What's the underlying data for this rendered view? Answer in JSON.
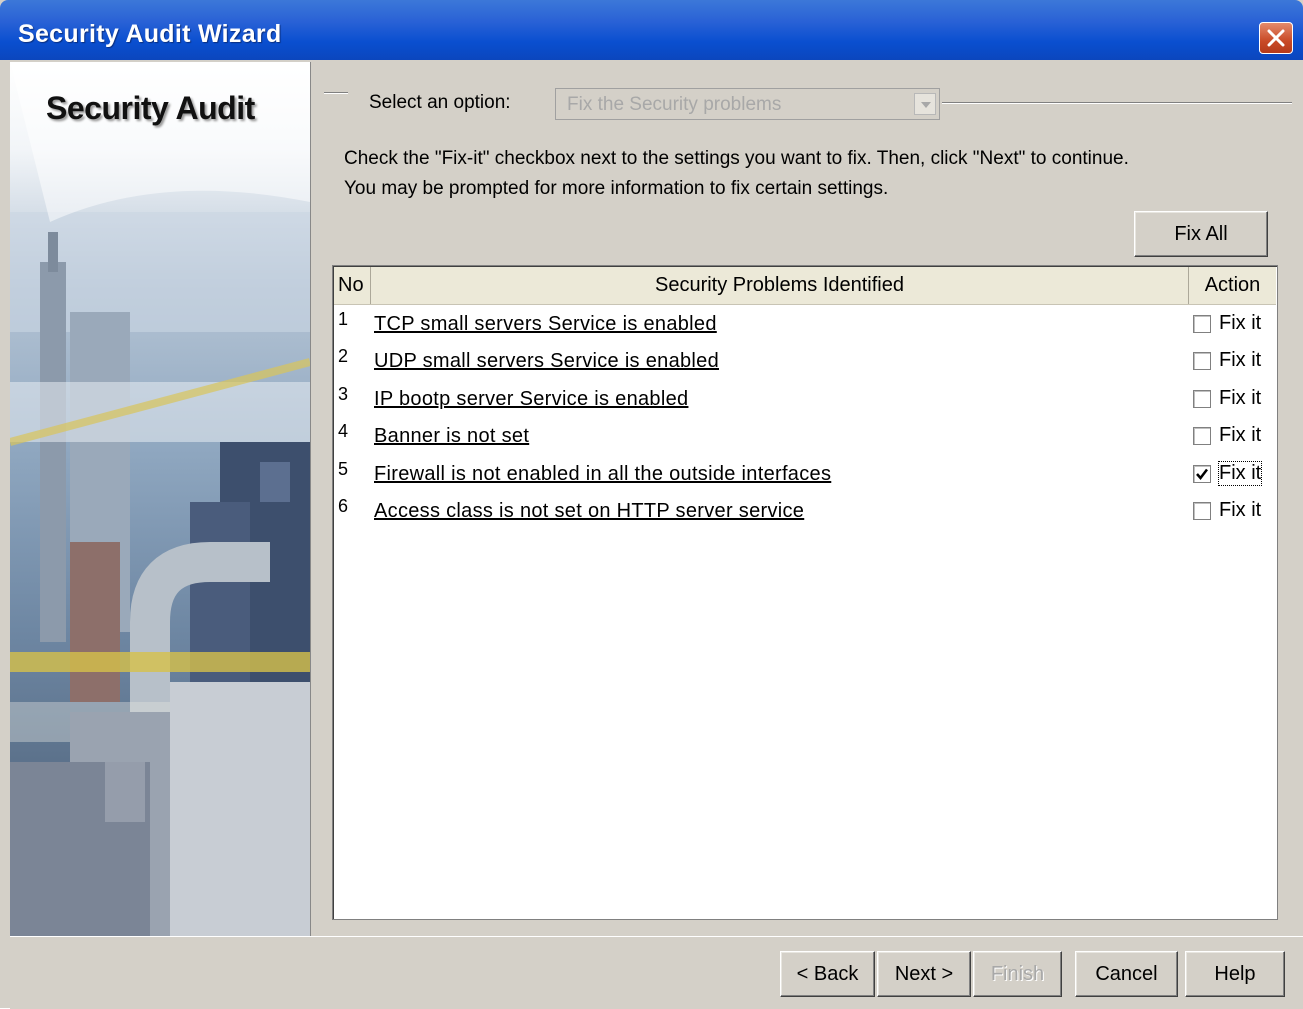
{
  "window": {
    "title": "Security Audit Wizard"
  },
  "sidebar": {
    "title": "Security Audit"
  },
  "option": {
    "label": "Select an option:",
    "selected": "Fix the Security problems"
  },
  "instructions": {
    "line1": "Check the \"Fix-it\" checkbox next to the settings you want to fix. Then, click \"Next\" to continue.",
    "line2": "You may be prompted for more information to fix certain settings."
  },
  "fix_all_label": "Fix All",
  "table": {
    "columns": {
      "no": "No",
      "problem": "Security Problems Identified",
      "action": "Action"
    },
    "rows": [
      {
        "no": "1",
        "problem": "TCP small servers Service is enabled",
        "action": "Fix it",
        "checked": false
      },
      {
        "no": "2",
        "problem": "UDP small servers Service is enabled",
        "action": "Fix it",
        "checked": false
      },
      {
        "no": "3",
        "problem": "IP bootp server Service is enabled",
        "action": "Fix it",
        "checked": false
      },
      {
        "no": "4",
        "problem": "Banner is not set",
        "action": "Fix it",
        "checked": false
      },
      {
        "no": "5",
        "problem": "Firewall is not enabled in all the outside interfaces",
        "action": "Fix it",
        "checked": true
      },
      {
        "no": "6",
        "problem": "Access class is not set on HTTP server service",
        "action": "Fix it",
        "checked": false
      }
    ]
  },
  "buttons": {
    "back": "< Back",
    "next": "Next >",
    "finish": "Finish",
    "cancel": "Cancel",
    "help": "Help"
  },
  "colors": {
    "title_bar": "#0a4fd0",
    "dialog_face": "#d4d0c8",
    "table_header": "#ece9d8",
    "close_button": "#c94a27"
  },
  "icons": [
    "close-icon",
    "dropdown-arrow-icon",
    "checkmark-icon"
  ]
}
